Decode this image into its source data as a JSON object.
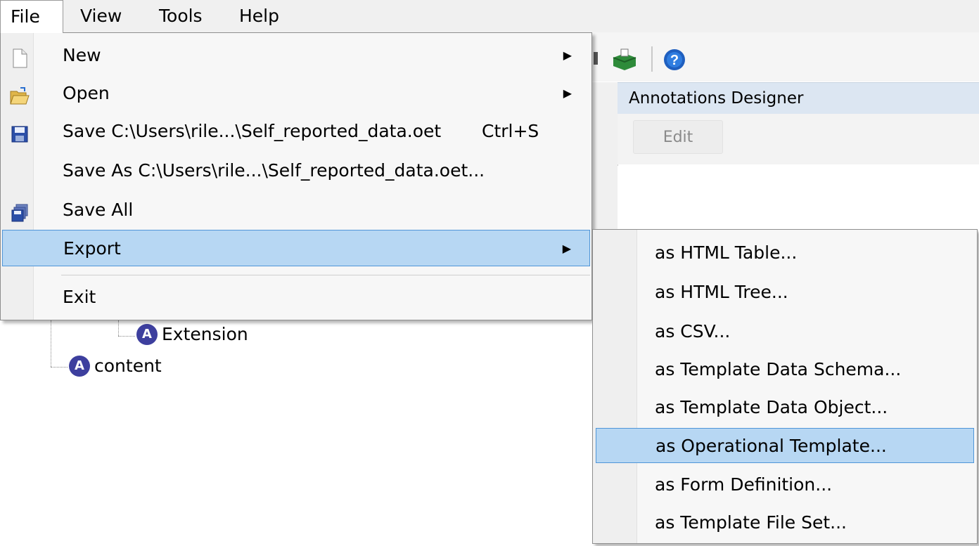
{
  "menubar": {
    "items": [
      {
        "label": "File",
        "active": true
      },
      {
        "label": "View"
      },
      {
        "label": "Tools"
      },
      {
        "label": "Help"
      }
    ]
  },
  "annotations_panel": {
    "title": "Annotations Designer",
    "edit_label": "Edit"
  },
  "tree": {
    "nodes": [
      {
        "label": "Extension",
        "icon": "attribute-icon"
      },
      {
        "label": "content",
        "icon": "attribute-icon"
      }
    ]
  },
  "file_menu": {
    "items": [
      {
        "label": "New",
        "icon": "new-document-icon",
        "submenu": true
      },
      {
        "label": "Open",
        "icon": "open-folder-icon",
        "submenu": true
      },
      {
        "label": "Save C:\\Users\\rile...\\Self_reported_data.oet",
        "shortcut": "Ctrl+S",
        "icon": "save-icon"
      },
      {
        "label": "Save As C:\\Users\\rile...\\Self_reported_data.oet..."
      },
      {
        "label": "Save All",
        "icon": "save-all-icon"
      },
      {
        "label": "Export",
        "submenu": true,
        "highlighted": true
      },
      {
        "label": "Exit"
      }
    ]
  },
  "export_submenu": {
    "items": [
      {
        "label": "as HTML Table..."
      },
      {
        "label": "as HTML Tree..."
      },
      {
        "label": "as CSV..."
      },
      {
        "label": "as Template Data Schema..."
      },
      {
        "label": "as Template Data Object..."
      },
      {
        "label": "as Operational Template...",
        "highlighted": true
      },
      {
        "label": "as Form Definition..."
      },
      {
        "label": "as Template File Set..."
      }
    ]
  },
  "colors": {
    "highlight_bg": "#b7d7f3",
    "highlight_border": "#4f95d8",
    "panel_header": "#dce6f2",
    "attribute_icon": "#3d3f9e"
  }
}
